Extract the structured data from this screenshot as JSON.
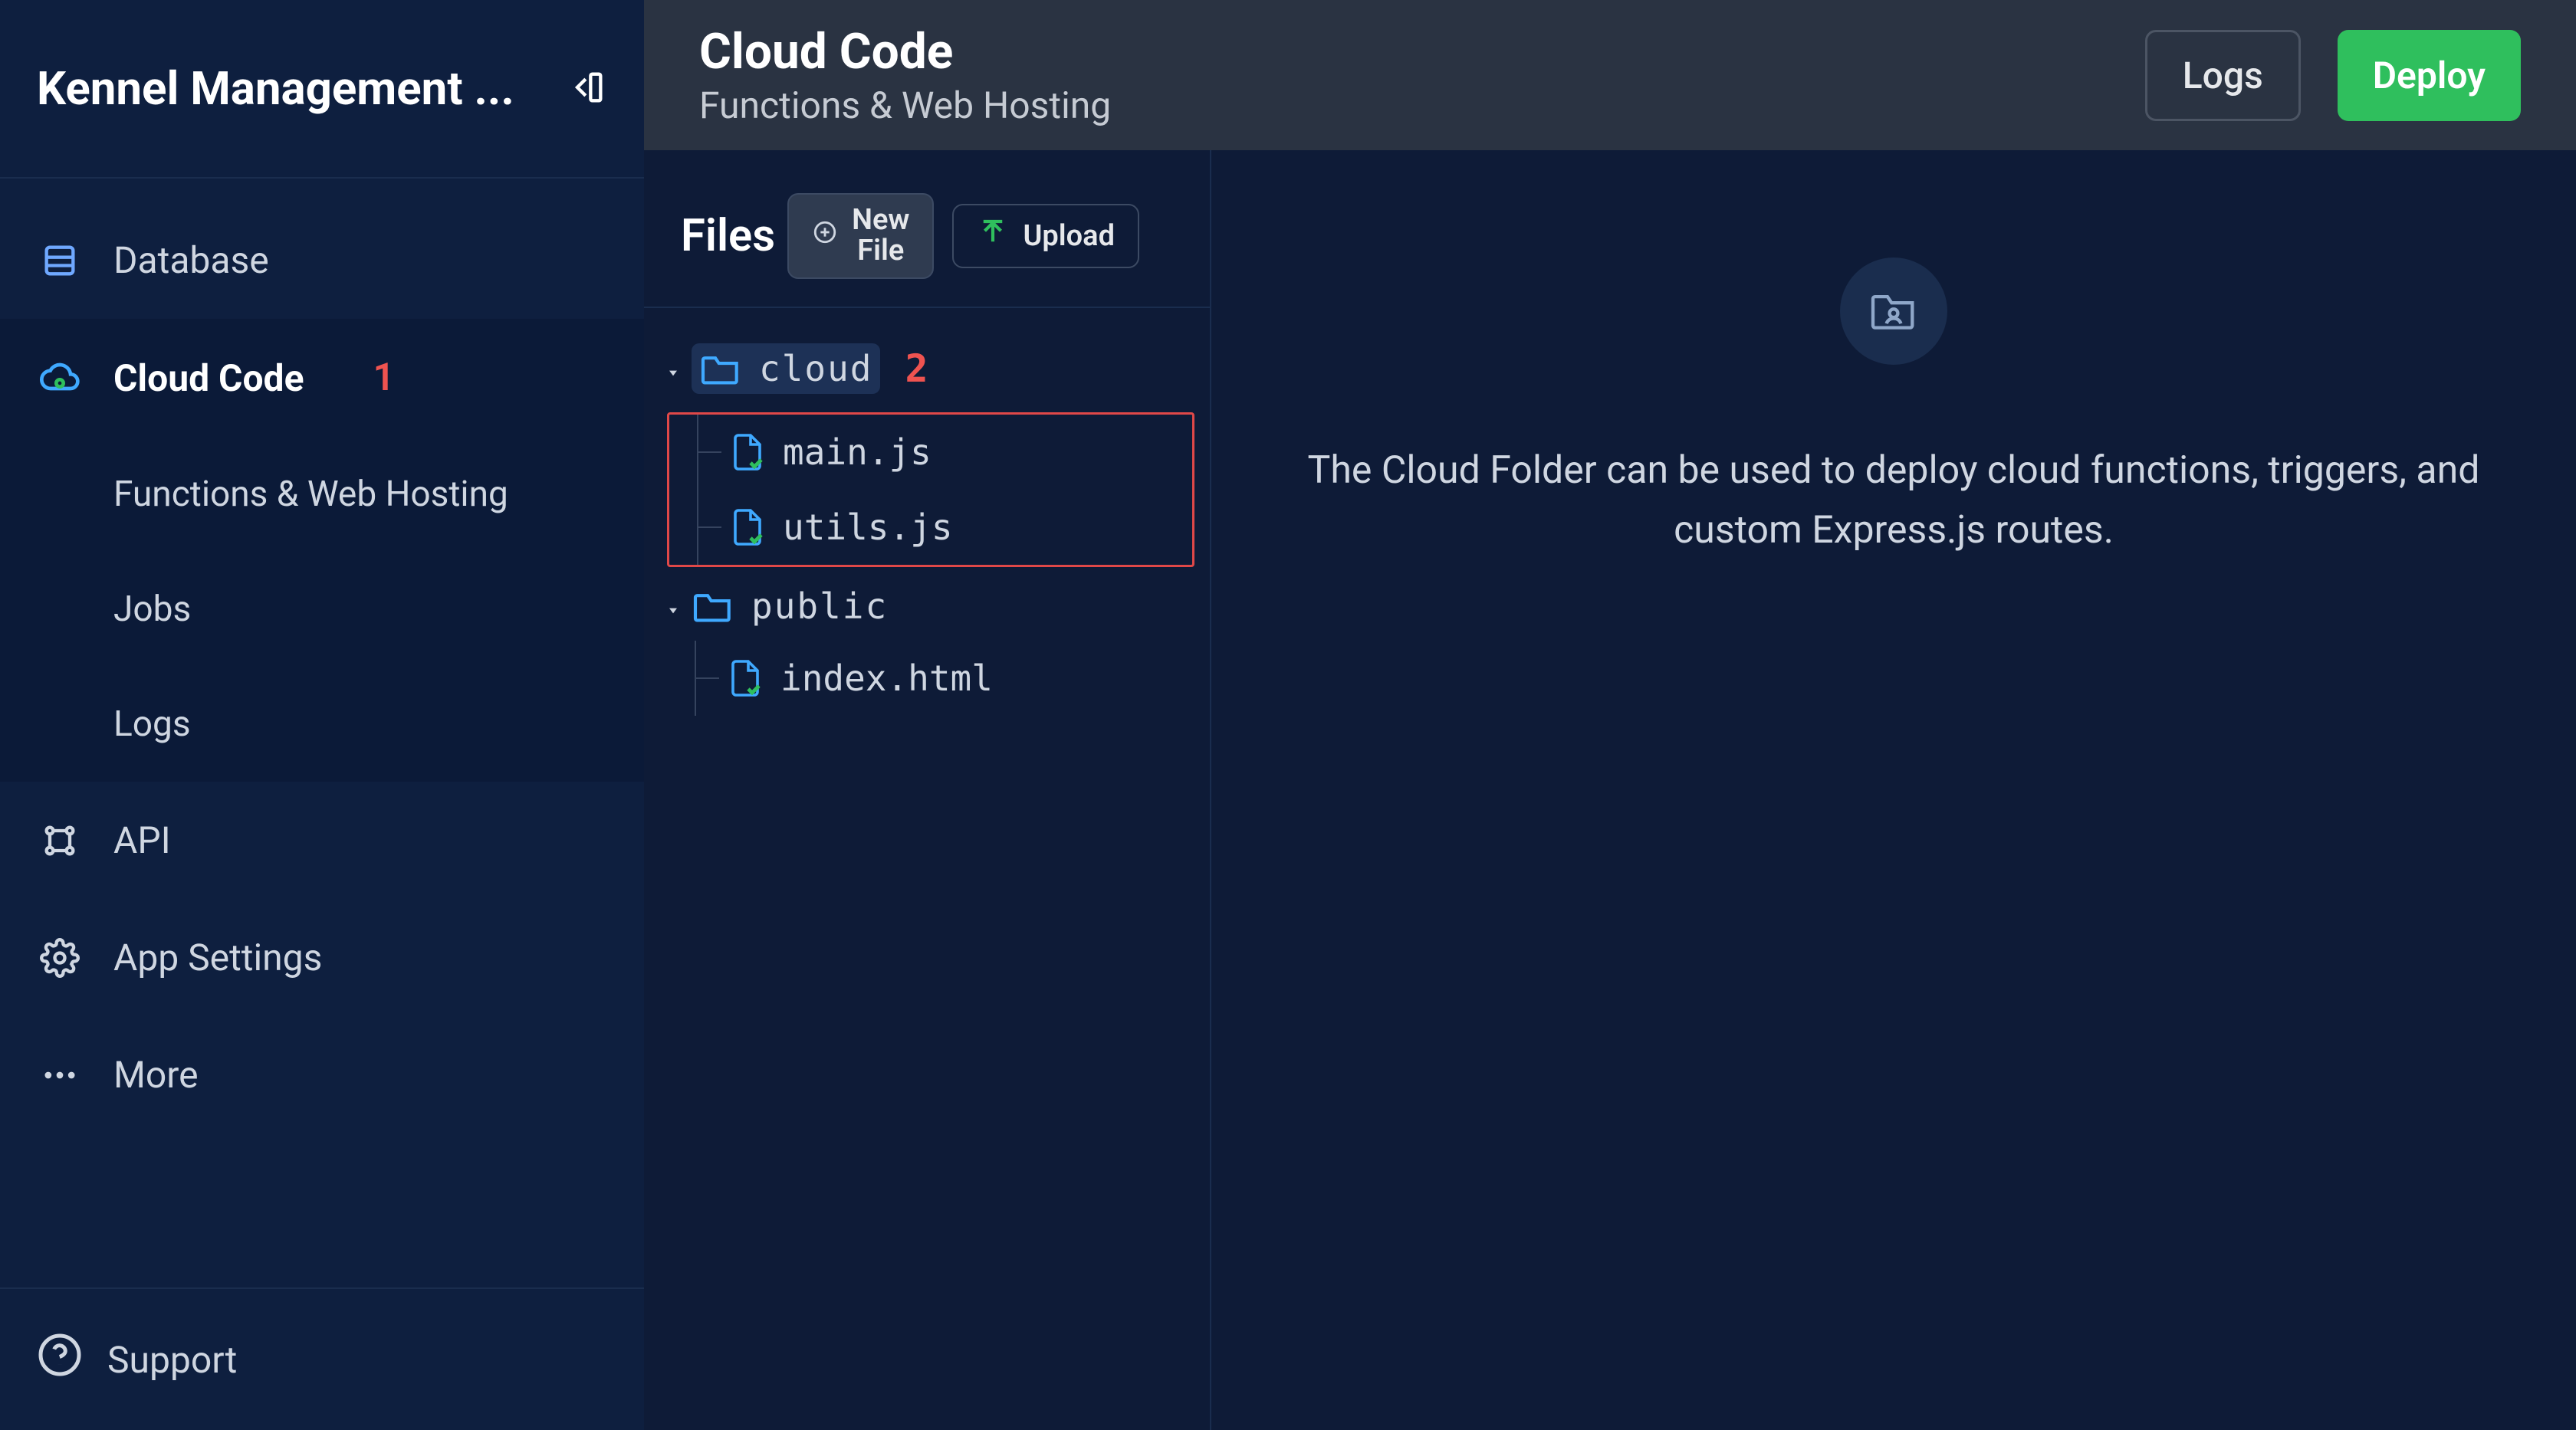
{
  "sidebar": {
    "title": "Kennel Management ...",
    "items": [
      {
        "label": "Database"
      },
      {
        "label": "Cloud Code",
        "annotation": "1"
      },
      {
        "label": "API"
      },
      {
        "label": "App Settings"
      },
      {
        "label": "More"
      }
    ],
    "cloud_code_sub": [
      {
        "label": "Functions & Web Hosting"
      },
      {
        "label": "Jobs"
      },
      {
        "label": "Logs"
      }
    ],
    "support": "Support"
  },
  "header": {
    "title": "Cloud Code",
    "subtitle": "Functions & Web Hosting",
    "logs_button": "Logs",
    "deploy_button": "Deploy"
  },
  "file_panel": {
    "title": "Files",
    "new_file_line1": "New",
    "new_file_line2": "File",
    "upload": "Upload",
    "tree": {
      "cloud": {
        "name": "cloud",
        "annotation": "2",
        "children": [
          {
            "name": "main.js"
          },
          {
            "name": "utils.js"
          }
        ]
      },
      "public": {
        "name": "public",
        "children": [
          {
            "name": "index.html"
          }
        ]
      }
    }
  },
  "preview": {
    "description": "The Cloud Folder can be used to deploy cloud functions, triggers, and custom Express.js routes."
  }
}
